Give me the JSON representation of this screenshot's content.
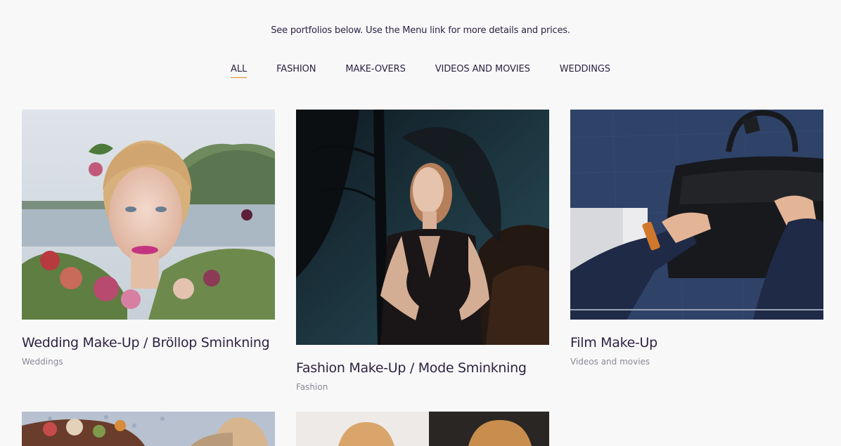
{
  "intro": "See portfolios below. Use the Menu link for more details and prices.",
  "filters": [
    {
      "label": "ALL",
      "active": true
    },
    {
      "label": "FASHION",
      "active": false
    },
    {
      "label": "MAKE-OVERS",
      "active": false
    },
    {
      "label": "VIDEOS AND MOVIES",
      "active": false
    },
    {
      "label": "WEDDINGS",
      "active": false
    }
  ],
  "cards": [
    {
      "title": "Wedding Make-Up / Bröllop Sminkning",
      "category": "Weddings"
    },
    {
      "title": "Fashion Make-Up / Mode Sminkning",
      "category": "Fashion"
    },
    {
      "title": "Film Make-Up",
      "category": "Videos and movies"
    }
  ],
  "colors": {
    "background": "#f8f8f9",
    "text": "#2e2342",
    "muted": "#8c8794",
    "active_underline": "#e08a1e"
  }
}
